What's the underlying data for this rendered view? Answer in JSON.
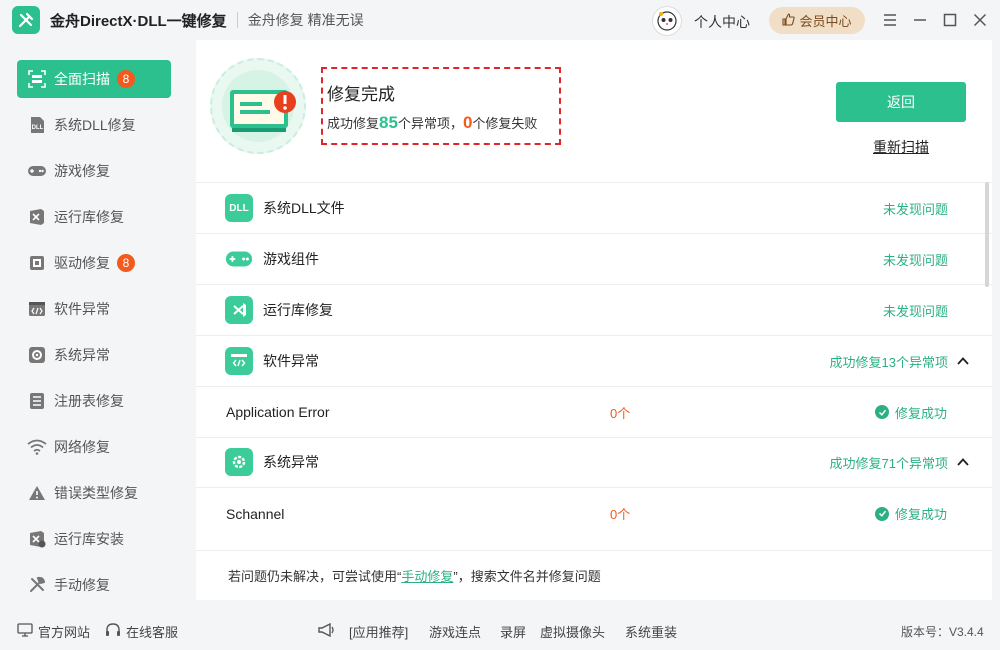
{
  "titlebar": {
    "app_title": "金舟DirectX·DLL一键修复",
    "slogan": "金舟修复 精准无误",
    "personal": "个人中心",
    "vip": "会员中心"
  },
  "sidebar": {
    "items": [
      {
        "label": "全面扫描",
        "badge": "8",
        "icon": "scan-icon"
      },
      {
        "label": "系统DLL修复",
        "icon": "dll-icon"
      },
      {
        "label": "游戏修复",
        "icon": "gamepad-icon"
      },
      {
        "label": "运行库修复",
        "icon": "runtime-icon"
      },
      {
        "label": "驱动修复",
        "badge": "8",
        "icon": "driver-icon"
      },
      {
        "label": "软件异常",
        "icon": "code-icon"
      },
      {
        "label": "系统异常",
        "icon": "gear-icon"
      },
      {
        "label": "注册表修复",
        "icon": "list-icon"
      },
      {
        "label": "网络修复",
        "icon": "wifi-icon"
      },
      {
        "label": "错误类型修复",
        "icon": "warning-icon"
      },
      {
        "label": "运行库安装",
        "icon": "install-icon"
      },
      {
        "label": "手动修复",
        "icon": "wrench-icon"
      }
    ]
  },
  "status": {
    "title": "修复完成",
    "prefix": "成功修复",
    "fixed": "85",
    "middle": "个异常项，",
    "failed": "0",
    "suffix": "个修复失败"
  },
  "actions": {
    "back": "返回",
    "rescan": "重新扫描"
  },
  "categories": [
    {
      "label": "系统DLL文件",
      "status": "未发现问题",
      "icon": "dll-file-icon"
    },
    {
      "label": "游戏组件",
      "status": "未发现问题",
      "icon": "gamepad-icon"
    },
    {
      "label": "运行库修复",
      "status": "未发现问题",
      "icon": "visual-studio-icon"
    },
    {
      "label": "软件异常",
      "status": "成功修复13个异常项",
      "icon": "code-window-icon"
    },
    {
      "label": "系统异常",
      "status": "成功修复71个异常项",
      "icon": "gear-icon"
    }
  ],
  "sub_items": [
    {
      "name": "Application Error",
      "count": "0个",
      "result": "修复成功"
    },
    {
      "name": "Schannel",
      "count": "0个",
      "result": "修复成功"
    }
  ],
  "hint": {
    "before": "若问题仍未解决，可尝试使用“",
    "link": "手动修复",
    "after": "”，搜索文件名并修复问题"
  },
  "footer": {
    "website": "官方网站",
    "service": "在线客服",
    "recommend": "[应用推荐]",
    "links": [
      "游戏连点",
      "录屏",
      "虚拟摄像头",
      "系统重装"
    ],
    "version": "版本号：V3.4.4"
  },
  "colors": {
    "accent": "#2cc08f",
    "badge": "#f25a1e",
    "error_frame": "#e0262b"
  }
}
